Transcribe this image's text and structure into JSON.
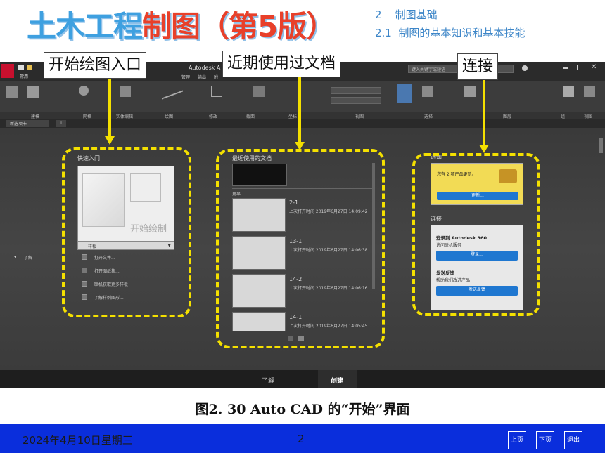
{
  "header": {
    "title_part1": "土木工程",
    "title_part2": "制图",
    "title_part3": "（第5版）",
    "chapter_num": "2",
    "chapter_title": "制图基础",
    "section_num": "2.1",
    "section_title": "制图的基本知识和基本技能"
  },
  "app": {
    "window_title": "Autodesk A",
    "search_placeholder": "键入关键字或短语",
    "tabs_top": [
      "常用",
      "管理",
      "输出",
      "附"
    ],
    "groups": [
      "建模",
      "网格",
      "实体编辑",
      "绘图",
      "修改",
      "截面",
      "坐标",
      "视图",
      "选择",
      "图层",
      "组",
      "视图"
    ],
    "doc_tab": "新选项卡"
  },
  "callouts": {
    "start": "开始绘图入口",
    "recent": "近期使用过文档",
    "connect": "连接"
  },
  "quick_start": {
    "heading": "快速入门",
    "start_drawing": "开始绘制",
    "template_label": "样板",
    "links": [
      "打开文件...",
      "打开图纸集...",
      "联机获取更多样板",
      "了解样例图形..."
    ]
  },
  "left_nav": {
    "learn_link": "了解"
  },
  "recent": {
    "heading": "最近使用的文档",
    "more_label": "更早",
    "docs": [
      {
        "name": "2-1",
        "opened": "上次打开时间 2019年6月27日 14:09:42"
      },
      {
        "name": "13-1",
        "opened": "上次打开时间 2019年6月27日 14:06:38"
      },
      {
        "name": "14-2",
        "opened": "上次打开时间 2019年6月27日 14:06:16"
      },
      {
        "name": "14-1",
        "opened": "上次打开时间 2019年6月27日 14:05:45"
      }
    ]
  },
  "notify": {
    "heading": "通知",
    "update_text": "您有 2 项产品更新。",
    "update_button": "更新..."
  },
  "connect": {
    "heading": "连接",
    "a360_title": "登录到 Autodesk 360",
    "a360_sub": "访问联机服务",
    "login_button": "登录...",
    "feedback_title": "发送反馈",
    "feedback_sub": "帮助我们改进产品",
    "feedback_button": "发送反馈"
  },
  "bottom_tabs": [
    "了解",
    "创建"
  ],
  "caption": "图2. 30  Auto CAD 的“开始”界面",
  "footer": {
    "date": "2024年4月10日星期三",
    "page": "2",
    "prev": "上页",
    "next": "下页",
    "exit": "退出"
  },
  "colors": {
    "highlight": "#f4e000",
    "title_blue": "#3ea0e0",
    "title_red": "#e8402a",
    "footer_blue": "#0a2edc"
  }
}
